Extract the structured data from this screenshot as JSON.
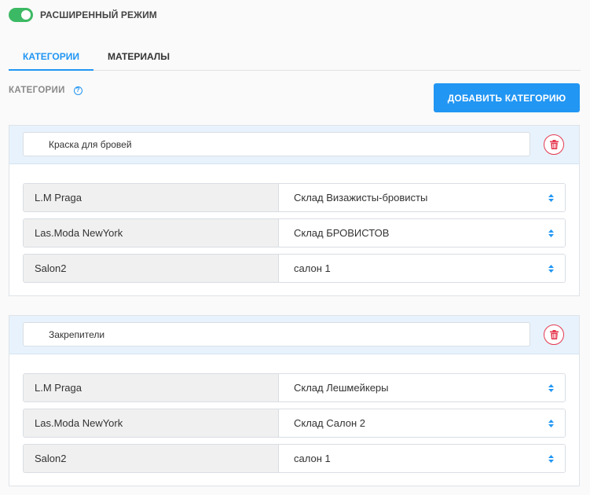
{
  "header": {
    "mode_toggle_label": "РАСШИРЕННЫЙ РЕЖИМ",
    "mode_toggle_on": true
  },
  "tabs": [
    {
      "label": "КАТЕГОРИИ",
      "active": true
    },
    {
      "label": "МАТЕРИАЛЫ",
      "active": false
    }
  ],
  "section": {
    "label": "КАТЕГОРИИ",
    "help_icon": "question-circle-icon",
    "add_button_label": "ДОБАВИТЬ КАТЕГОРИЮ"
  },
  "categories": [
    {
      "name": "Краска для бровей",
      "rows": [
        {
          "salon": "L.M Praga",
          "warehouse": "Склад Визажисты-бровисты"
        },
        {
          "salon": "Las.Moda NewYork",
          "warehouse": "Склад БРОВИСТОВ"
        },
        {
          "salon": "Salon2",
          "warehouse": "салон 1"
        }
      ]
    },
    {
      "name": "Закрепители",
      "rows": [
        {
          "salon": "L.M Praga",
          "warehouse": "Склад Лешмейкеры"
        },
        {
          "salon": "Las.Moda NewYork",
          "warehouse": "Склад Салон 2"
        },
        {
          "salon": "Salon2",
          "warehouse": "салон 1"
        }
      ]
    }
  ],
  "colors": {
    "accent": "#2196f3",
    "toggle_on": "#3cb964",
    "delete": "#e53950",
    "card_header": "#e7f2fc"
  }
}
